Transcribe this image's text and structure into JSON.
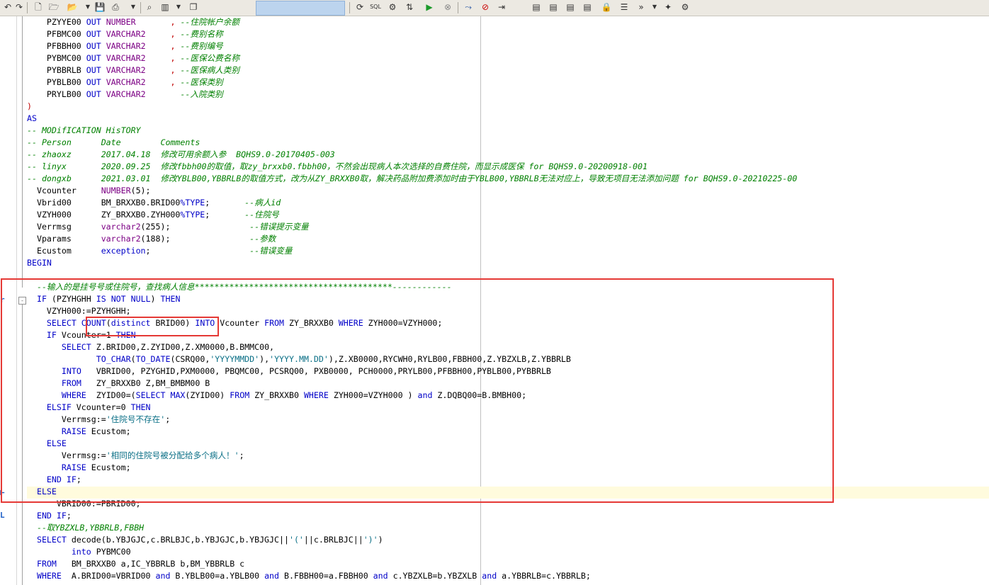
{
  "toolbar": {
    "buttons": [
      "undo-icon",
      "redo-icon",
      "new-icon",
      "open-icon",
      "dropdown-icon",
      "open-folder-icon",
      "dropdown-icon",
      "save-icon",
      "print-icon",
      "dropdown-icon",
      "find-icon",
      "layout-icon",
      "dropdown-icon",
      "copy-icon",
      "combo",
      "refresh-icon",
      "sql-icon",
      "compile-icon",
      "execute-icon",
      "stop-icon",
      "debug-icon",
      "no-icon",
      "indent-icon",
      "doc-icon",
      "doc2-icon",
      "doc3-icon",
      "doc4-icon",
      "lock-icon",
      "list-icon",
      "forward-icon",
      "dropdown-icon",
      "bulb-icon",
      "gear-icon"
    ],
    "sql_label": "SQL"
  },
  "code_lines": [
    [
      [
        "    PZYYE00 "
      ],
      [
        "OUT",
        "kw"
      ],
      [
        " "
      ],
      [
        "NUMBER",
        "ty"
      ],
      [
        "       "
      ],
      [
        ", ",
        "op"
      ],
      [
        "--住院帐户余额",
        "cm"
      ]
    ],
    [
      [
        "    PFBMC00 "
      ],
      [
        "OUT",
        "kw"
      ],
      [
        " "
      ],
      [
        "VARCHAR2",
        "ty"
      ],
      [
        "     "
      ],
      [
        ", ",
        "op"
      ],
      [
        "--费别名称",
        "cm"
      ]
    ],
    [
      [
        "    PFBBH00 "
      ],
      [
        "OUT",
        "kw"
      ],
      [
        " "
      ],
      [
        "VARCHAR2",
        "ty"
      ],
      [
        "     "
      ],
      [
        ", ",
        "op"
      ],
      [
        "--费别编号",
        "cm"
      ]
    ],
    [
      [
        "    PYBMC00 "
      ],
      [
        "OUT",
        "kw"
      ],
      [
        " "
      ],
      [
        "VARCHAR2",
        "ty"
      ],
      [
        "     "
      ],
      [
        ", ",
        "op"
      ],
      [
        "--医保公费名称",
        "cm"
      ]
    ],
    [
      [
        "    PYBBRLB "
      ],
      [
        "OUT",
        "kw"
      ],
      [
        " "
      ],
      [
        "VARCHAR2",
        "ty"
      ],
      [
        "     "
      ],
      [
        ", ",
        "op"
      ],
      [
        "--医保病人类别",
        "cm"
      ]
    ],
    [
      [
        "    PYBLB00 "
      ],
      [
        "OUT",
        "kw"
      ],
      [
        " "
      ],
      [
        "VARCHAR2",
        "ty"
      ],
      [
        "     "
      ],
      [
        ", ",
        "op"
      ],
      [
        "--医保类别",
        "cm"
      ]
    ],
    [
      [
        "    PRYLB00 "
      ],
      [
        "OUT",
        "kw"
      ],
      [
        " "
      ],
      [
        "VARCHAR2",
        "ty"
      ],
      [
        "       "
      ],
      [
        "--入院类别",
        "cm"
      ]
    ],
    [
      [
        ")",
        "op"
      ]
    ],
    [
      [
        "AS",
        "kw"
      ]
    ],
    [
      [
        "-- MODifICATION HisTORY",
        "cm"
      ]
    ],
    [
      [
        "-- Person      Date        Comments",
        "cm"
      ]
    ],
    [
      [
        "-- zhaoxz      2017.04.18  修改可用余额入参  BQHS9.0-20170405-003",
        "cm"
      ]
    ],
    [
      [
        "-- linyx       2020.09.25  修改fbbh00的取值，取zy_brxxb0.fbbh00，不然会出现病人本次选择的自费住院，而显示成医保 for BQHS9.0-20200918-001",
        "cm"
      ]
    ],
    [
      [
        "-- dongxb      2021.03.01  修改YBLB00,YBBRLB的取值方式，改为从ZY_BRXXB0取，解决药品附加费添加时由于YBLB00,YBBRLB无法对应上，导致无项目无法添加问题 for BQHS9.0-20210225-00",
        "cm"
      ]
    ],
    [
      [
        "  Vcounter     "
      ],
      [
        "NUMBER",
        "ty"
      ],
      [
        "(5);"
      ]
    ],
    [
      [
        "  Vbrid00      BM_BRXXB0.BRID00"
      ],
      [
        "%TYPE",
        "kw"
      ],
      [
        ";       "
      ],
      [
        "--病人id",
        "cm"
      ]
    ],
    [
      [
        "  VZYH000      ZY_BRXXB0.ZYH000"
      ],
      [
        "%TYPE",
        "kw"
      ],
      [
        ";       "
      ],
      [
        "--住院号",
        "cm"
      ]
    ],
    [
      [
        "  Verrmsg      "
      ],
      [
        "varchar2",
        "ty"
      ],
      [
        "(255);                "
      ],
      [
        "--错误提示变量",
        "cm"
      ]
    ],
    [
      [
        "  Vparams      "
      ],
      [
        "varchar2",
        "ty"
      ],
      [
        "(188);                "
      ],
      [
        "--参数",
        "cm"
      ]
    ],
    [
      [
        "  Ecustom      "
      ],
      [
        "exception",
        "kw"
      ],
      [
        ";                    "
      ],
      [
        "--错误变量",
        "cm"
      ]
    ],
    [
      [
        "BEGIN",
        "kw"
      ]
    ],
    [
      [
        ""
      ]
    ],
    [
      [
        "  --输入的是挂号号或住院号，查找病人信息****************************************------------",
        "cm"
      ]
    ],
    [
      [
        "  "
      ],
      [
        "IF",
        "kw"
      ],
      [
        " (PZYHGHH "
      ],
      [
        "IS NOT NULL",
        "kw"
      ],
      [
        ") "
      ],
      [
        "THEN",
        "kw"
      ]
    ],
    [
      [
        "    VZYH000:=PZYHGHH;"
      ]
    ],
    [
      [
        "    "
      ],
      [
        "SELECT",
        "kw"
      ],
      [
        " "
      ],
      [
        "COUNT",
        "kw"
      ],
      [
        "("
      ],
      [
        "distinct",
        "kw"
      ],
      [
        " BRID00) "
      ],
      [
        "INTO",
        "kw"
      ],
      [
        " Vcounter "
      ],
      [
        "FROM",
        "kw"
      ],
      [
        " ZY_BRXXB0 "
      ],
      [
        "WHERE",
        "kw"
      ],
      [
        " ZYH000=VZYH000;"
      ]
    ],
    [
      [
        "    "
      ],
      [
        "IF",
        "kw"
      ],
      [
        " Vcounter=1 "
      ],
      [
        "THEN",
        "kw"
      ]
    ],
    [
      [
        "       "
      ],
      [
        "SELECT",
        "kw"
      ],
      [
        " Z.BRID00,Z.ZYID00,Z.XM0000,B.BMMC00,"
      ]
    ],
    [
      [
        "              "
      ],
      [
        "TO_CHAR",
        "kw"
      ],
      [
        "("
      ],
      [
        "TO_DATE",
        "kw"
      ],
      [
        "(CSRQ00,"
      ],
      [
        "'YYYYMMDD'",
        "st"
      ],
      [
        "),"
      ],
      [
        "'YYYY.MM.DD'",
        "st"
      ],
      [
        "),Z.XB0000,RYCWH0,RYLB00,FBBH00,Z.YBZXLB,Z.YBBRLB"
      ]
    ],
    [
      [
        "       "
      ],
      [
        "INTO",
        "kw"
      ],
      [
        "   VBRID00, PZYGHID,PXM0000, PBQMC00, PCSRQ00, PXB0000, PCH0000,PRYLB00,PFBBH00,PYBLB00,PYBBRLB"
      ]
    ],
    [
      [
        "       "
      ],
      [
        "FROM",
        "kw"
      ],
      [
        "   ZY_BRXXB0 Z,BM_BMBM00 B"
      ]
    ],
    [
      [
        "       "
      ],
      [
        "WHERE",
        "kw"
      ],
      [
        "  ZYID00=("
      ],
      [
        "SELECT",
        "kw"
      ],
      [
        " "
      ],
      [
        "MAX",
        "kw"
      ],
      [
        "(ZYID00) "
      ],
      [
        "FROM",
        "kw"
      ],
      [
        " ZY_BRXXB0 "
      ],
      [
        "WHERE",
        "kw"
      ],
      [
        " ZYH000=VZYH000 ) "
      ],
      [
        "and",
        "kw"
      ],
      [
        " Z.DQBQ00=B.BMBH00;"
      ]
    ],
    [
      [
        "    "
      ],
      [
        "ELSIF",
        "kw"
      ],
      [
        " Vcounter=0 "
      ],
      [
        "THEN",
        "kw"
      ]
    ],
    [
      [
        "       Verrmsg:="
      ],
      [
        "'住院号不存在'",
        "st"
      ],
      [
        ";"
      ]
    ],
    [
      [
        "       "
      ],
      [
        "RAISE",
        "kw"
      ],
      [
        " Ecustom;"
      ]
    ],
    [
      [
        "    "
      ],
      [
        "ELSE",
        "kw"
      ]
    ],
    [
      [
        "       Verrmsg:="
      ],
      [
        "'相同的住院号被分配给多个病人！'",
        "st"
      ],
      [
        ";"
      ]
    ],
    [
      [
        "       "
      ],
      [
        "RAISE",
        "kw"
      ],
      [
        " Ecustom;"
      ]
    ],
    [
      [
        "    "
      ],
      [
        "END IF",
        "kw"
      ],
      [
        ";"
      ]
    ],
    [
      [
        "  "
      ],
      [
        "ELSE",
        "kw"
      ]
    ],
    [
      [
        "      VBRID00:=PBRID00;"
      ]
    ],
    [
      [
        "  "
      ],
      [
        "END IF",
        "kw"
      ],
      [
        ";"
      ]
    ],
    [
      [
        "  --取YBZXLB,YBBRLB,FBBH",
        "cm"
      ]
    ],
    [
      [
        "  "
      ],
      [
        "SELECT",
        "kw"
      ],
      [
        " decode(b.YBJGJC,c.BRLBJC,b.YBJGJC,b.YBJGJC||"
      ],
      [
        "'('",
        "st"
      ],
      [
        "||c.BRLBJC||"
      ],
      [
        "')'",
        "st"
      ],
      [
        ")"
      ]
    ],
    [
      [
        "         "
      ],
      [
        "into",
        "kw"
      ],
      [
        " PYBMC00"
      ]
    ],
    [
      [
        "  "
      ],
      [
        "FROM",
        "kw"
      ],
      [
        "   BM_BRXXB0 a,IC_YBBRLB b,BM_YBBRLB c"
      ]
    ],
    [
      [
        "  "
      ],
      [
        "WHERE",
        "kw"
      ],
      [
        "  A.BRID00=VBRID00 "
      ],
      [
        "and",
        "kw"
      ],
      [
        " B.YBLB00=a.YBLB00 "
      ],
      [
        "and",
        "kw"
      ],
      [
        " B.FBBH00=a.FBBH00 "
      ],
      [
        "and",
        "kw"
      ],
      [
        " c.YBZXLB=b.YBZXLB "
      ],
      [
        "and",
        "kw"
      ],
      [
        " a.YBBRLB=c.YBBRLB;"
      ]
    ]
  ]
}
